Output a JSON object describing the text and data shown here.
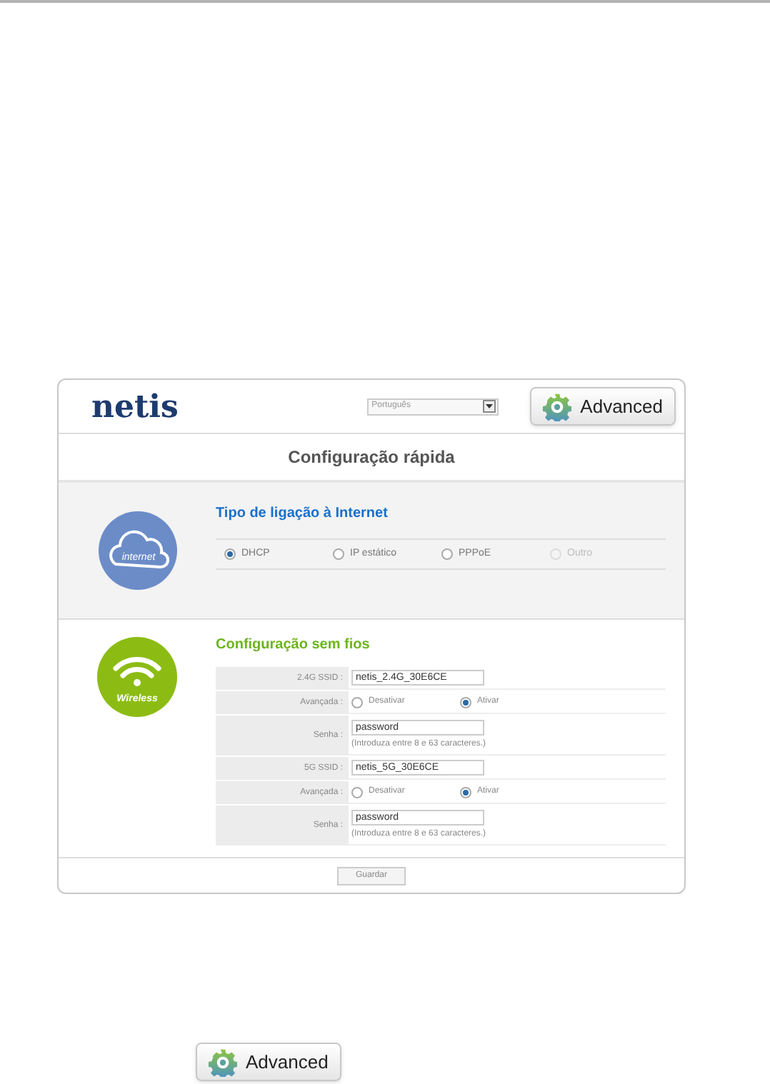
{
  "header": {
    "logo": "netis",
    "language": "Português",
    "advanced_button": "Advanced"
  },
  "title": "Configuração rápida",
  "internet": {
    "icon_label": "internet",
    "heading": "Tipo de ligação à Internet",
    "options": [
      {
        "label": "DHCP",
        "selected": true,
        "disabled": false
      },
      {
        "label": "IP estático",
        "selected": false,
        "disabled": false
      },
      {
        "label": "PPPoE",
        "selected": false,
        "disabled": false
      },
      {
        "label": "Outro",
        "selected": false,
        "disabled": true
      }
    ]
  },
  "wireless": {
    "icon_label": "Wireless",
    "heading": "Configuração sem fios",
    "rows": [
      {
        "kind": "text",
        "label": "2.4G SSID :",
        "value": "netis_2.4G_30E6CE"
      },
      {
        "kind": "radio",
        "label": "Avançada :",
        "options": [
          {
            "label": "Desativar",
            "selected": false
          },
          {
            "label": "Ativar",
            "selected": true
          }
        ]
      },
      {
        "kind": "password",
        "label": "Senha :",
        "value": "password",
        "hint": "(Introduza entre 8 e 63 caracteres.)"
      },
      {
        "kind": "text",
        "label": "5G SSID :",
        "value": "netis_5G_30E6CE"
      },
      {
        "kind": "radio",
        "label": "Avançada :",
        "options": [
          {
            "label": "Desativar",
            "selected": false
          },
          {
            "label": "Ativar",
            "selected": true
          }
        ]
      },
      {
        "kind": "password",
        "label": "Senha :",
        "value": "password",
        "hint": "(Introduza entre 8 e 63 caracteres.)"
      }
    ]
  },
  "save_button": "Guardar",
  "footer_button": "Advanced"
}
